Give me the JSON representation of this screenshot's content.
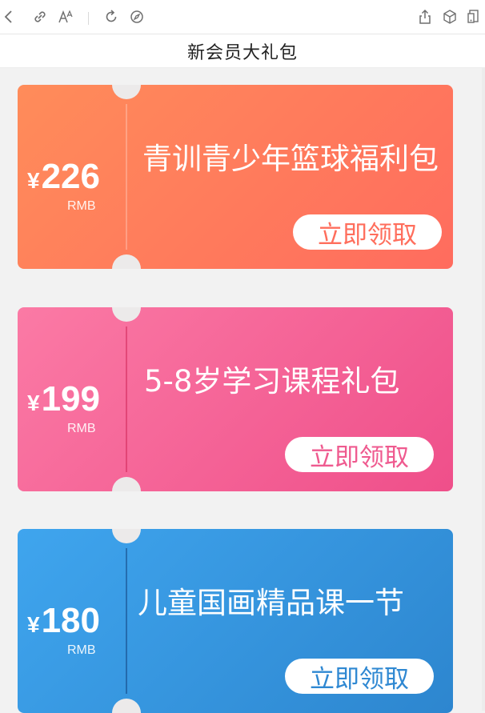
{
  "toolbar": {
    "icons": [
      "back-icon",
      "link-icon",
      "font-size-icon",
      "refresh-icon",
      "compass-icon",
      "share-icon",
      "cube-icon",
      "device-icon"
    ]
  },
  "page": {
    "title": "新会员大礼包"
  },
  "coupons": [
    {
      "currency": "¥",
      "amount": "226",
      "unit": "RMB",
      "title": "青训青少年篮球福利包",
      "button": "立即领取",
      "color_start": "#ff8c5a",
      "color_end": "#ff6c5e"
    },
    {
      "currency": "¥",
      "amount": "199",
      "unit": "RMB",
      "title": "5-8岁学习课程礼包",
      "button": "立即领取",
      "color_start": "#fb7aa5",
      "color_end": "#ef4f8a"
    },
    {
      "currency": "¥",
      "amount": "180",
      "unit": "RMB",
      "title": "儿童国画精品课一节",
      "button": "立即领取",
      "color_start": "#3fa5ee",
      "color_end": "#2d86cf"
    }
  ]
}
